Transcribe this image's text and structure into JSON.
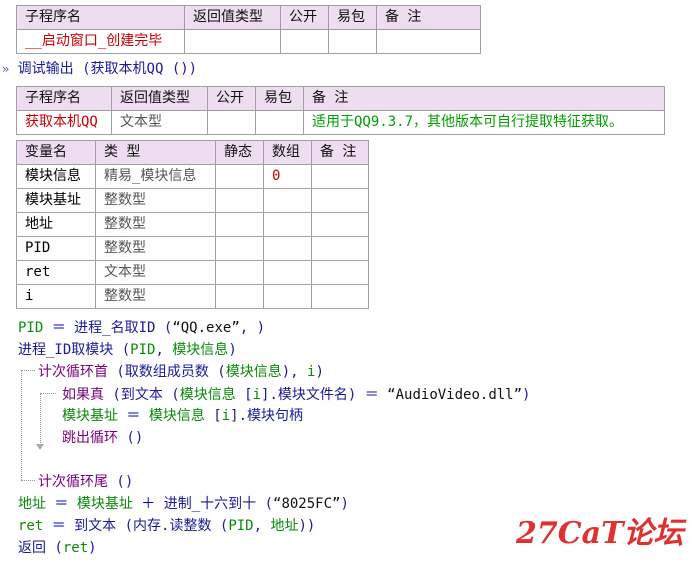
{
  "sub1": {
    "headers": [
      "子程序名",
      "返回值类型",
      "公开",
      "易包",
      "备 注"
    ],
    "name": "__启动窗口_创建完毕"
  },
  "debug": {
    "prefix": "»",
    "text": "调试输出 (获取本机QQ ())"
  },
  "sub2": {
    "headers": [
      "子程序名",
      "返回值类型",
      "公开",
      "易包",
      "备 注"
    ],
    "name": "获取本机QQ",
    "return_type": "文本型",
    "note": "适用于QQ9.3.7，其他版本可自行提取特征获取。"
  },
  "vars": {
    "headers": [
      "变量名",
      "类 型",
      "静态",
      "数组",
      "备 注"
    ],
    "rows": [
      {
        "name": "模块信息",
        "type": "精易_模块信息",
        "array": "0"
      },
      {
        "name": "模块基址",
        "type": "整数型",
        "array": ""
      },
      {
        "name": "地址",
        "type": "整数型",
        "array": ""
      },
      {
        "name": "PID",
        "type": "整数型",
        "array": ""
      },
      {
        "name": "ret",
        "type": "文本型",
        "array": ""
      },
      {
        "name": "i",
        "type": "整数型",
        "array": ""
      }
    ]
  },
  "code": {
    "l1": [
      "PID",
      " ＝ ",
      "进程_名取ID",
      " (",
      "“QQ.exe”",
      ", )"
    ],
    "l2": [
      "进程_ID取模块",
      " (",
      "PID",
      ", ",
      "模块信息",
      ")"
    ],
    "l3": [
      "计次循环首",
      " (",
      "取数组成员数",
      " (",
      "模块信息",
      "), ",
      "i",
      ")"
    ],
    "l4": [
      "如果真",
      " (",
      "到文本",
      " (",
      "模块信息",
      " [",
      "i",
      "].",
      "模块文件名",
      ") ＝ ",
      "“AudioVideo.dll”",
      ")"
    ],
    "l5": [
      "模块基址",
      " ＝ ",
      "模块信息",
      " [",
      "i",
      "].",
      "模块句柄"
    ],
    "l6": [
      "跳出循环",
      " ()"
    ],
    "l7": [
      "计次循环尾",
      " ()"
    ],
    "l8": [
      "地址",
      " ＝ ",
      "模块基址",
      " ＋ ",
      "进制_十六到十",
      " (",
      "“8025FC”",
      ")"
    ],
    "l9": [
      "ret",
      " ＝ ",
      "到文本",
      " (",
      "内存.读整数",
      " (",
      "PID",
      ", ",
      "地址",
      "))"
    ],
    "l10": [
      "返回",
      " (",
      "ret",
      ")"
    ]
  },
  "watermark": "27CaT论坛"
}
